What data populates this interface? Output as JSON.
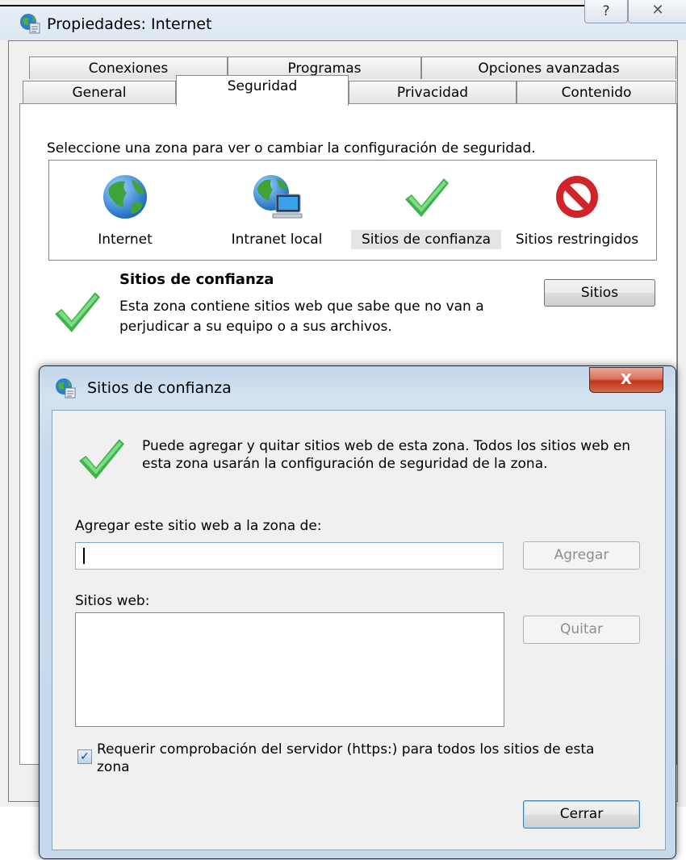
{
  "main_window": {
    "title": "Propiedades: Internet",
    "help_button": "?",
    "close_button": "✕",
    "tabs_row1": [
      "Conexiones",
      "Programas",
      "Opciones avanzadas"
    ],
    "tabs_row2": [
      "General",
      "Seguridad",
      "Privacidad",
      "Contenido"
    ],
    "active_tab": "Seguridad",
    "zone_intro": "Seleccione una zona para ver o cambiar la configuración de seguridad.",
    "zones": [
      {
        "label": "Internet",
        "icon": "globe-icon"
      },
      {
        "label": "Intranet local",
        "icon": "intranet-icon"
      },
      {
        "label": "Sitios de confianza",
        "icon": "checkmark-icon"
      },
      {
        "label": "Sitios restringidos",
        "icon": "restricted-icon"
      }
    ],
    "selected_zone": "Sitios de confianza",
    "zone_title": "Sitios de confianza",
    "zone_description": "Esta zona contiene sitios web que sabe que no van a perjudicar a su equipo o a sus archivos.",
    "sites_button": "Sitios"
  },
  "dialog": {
    "title": "Sitios de confianza",
    "close_button": "X",
    "info_text": "Puede agregar y quitar sitios web de esta zona. Todos los sitios web en esta zona usarán la configuración de seguridad de la zona.",
    "add_label": "Agregar este sitio web a la zona de:",
    "url_value": "",
    "add_button": "Agregar",
    "sites_label": "Sitios web:",
    "sites_list": [],
    "remove_button": "Quitar",
    "https_checkbox": {
      "checked": true,
      "label": "Requerir comprobación del servidor (https:) para todos los sitios de esta zona"
    },
    "close_dialog_button": "Cerrar"
  },
  "colors": {
    "check_green": "#3cb44a",
    "restricted_red": "#d0242a",
    "dialog_frame": "#c6d8eb",
    "close_red": "#c2331b"
  }
}
